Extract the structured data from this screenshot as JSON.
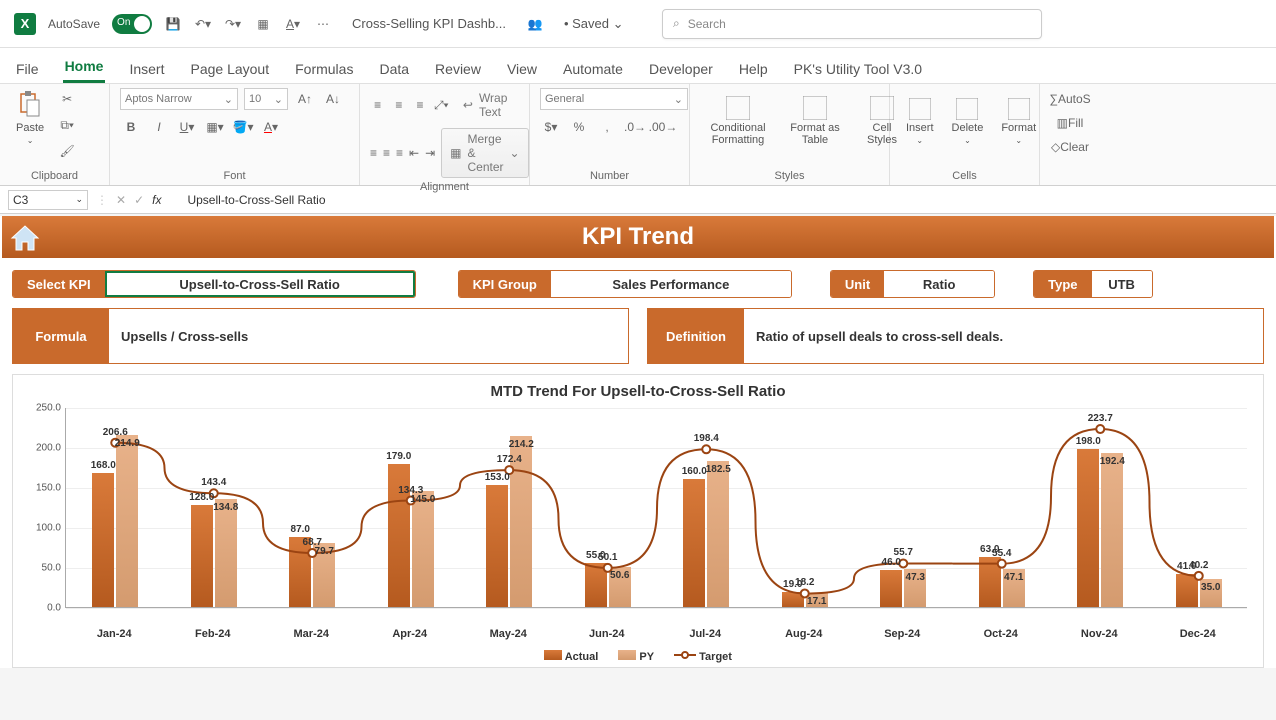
{
  "titlebar": {
    "autosave": "AutoSave",
    "toggle": "On",
    "doc_title": "Cross-Selling KPI Dashb...",
    "saved": "Saved",
    "search_placeholder": "Search"
  },
  "tabs": [
    "File",
    "Home",
    "Insert",
    "Page Layout",
    "Formulas",
    "Data",
    "Review",
    "View",
    "Automate",
    "Developer",
    "Help",
    "PK's Utility Tool V3.0"
  ],
  "active_tab": "Home",
  "ribbon": {
    "paste": "Paste",
    "clipboard": "Clipboard",
    "font_name": "Aptos Narrow",
    "font_size": "10",
    "font": "Font",
    "wrap": "Wrap Text",
    "merge": "Merge & Center",
    "alignment": "Alignment",
    "general": "General",
    "number": "Number",
    "cond_fmt": "Conditional Formatting",
    "fmt_table": "Format as Table",
    "cell_styles": "Cell Styles",
    "styles": "Styles",
    "insert": "Insert",
    "delete": "Delete",
    "format": "Format",
    "cells": "Cells",
    "autosum": "AutoS",
    "fill": "Fill",
    "clear": "Clear"
  },
  "formula_bar": {
    "cell": "C3",
    "value": "Upsell-to-Cross-Sell Ratio"
  },
  "dashboard": {
    "header": "KPI Trend",
    "select_kpi_label": "Select KPI",
    "select_kpi_value": "Upsell-to-Cross-Sell Ratio",
    "kpi_group_label": "KPI Group",
    "kpi_group_value": "Sales Performance",
    "unit_label": "Unit",
    "unit_value": "Ratio",
    "type_label": "Type",
    "type_value": "UTB",
    "formula_label": "Formula",
    "formula_value": "Upsells / Cross-sells",
    "definition_label": "Definition",
    "definition_value": "Ratio of upsell deals to cross-sell deals.",
    "chart_title": "MTD Trend For Upsell-to-Cross-Sell Ratio",
    "legend_actual": "Actual",
    "legend_py": "PY",
    "legend_target": "Target"
  },
  "chart_data": {
    "type": "bar",
    "ylim": [
      0,
      250
    ],
    "yticks": [
      "0.0",
      "50.0",
      "100.0",
      "150.0",
      "200.0",
      "250.0"
    ],
    "categories": [
      "Jan-24",
      "Feb-24",
      "Mar-24",
      "Apr-24",
      "May-24",
      "Jun-24",
      "Jul-24",
      "Aug-24",
      "Sep-24",
      "Oct-24",
      "Nov-24",
      "Dec-24"
    ],
    "series": [
      {
        "name": "Actual",
        "values": [
          168.0,
          128.0,
          87.0,
          179.0,
          153.0,
          55.0,
          160.0,
          19.0,
          46.0,
          63.0,
          198.0,
          41.0
        ]
      },
      {
        "name": "PY",
        "values": [
          214.9,
          134.8,
          79.7,
          145.0,
          214.2,
          50.6,
          182.5,
          17.1,
          47.3,
          47.1,
          192.4,
          35.0
        ]
      },
      {
        "name": "Target",
        "values": [
          206.6,
          143.4,
          68.7,
          134.3,
          172.4,
          50.1,
          198.4,
          18.2,
          55.7,
          55.4,
          223.7,
          40.2
        ]
      }
    ]
  }
}
